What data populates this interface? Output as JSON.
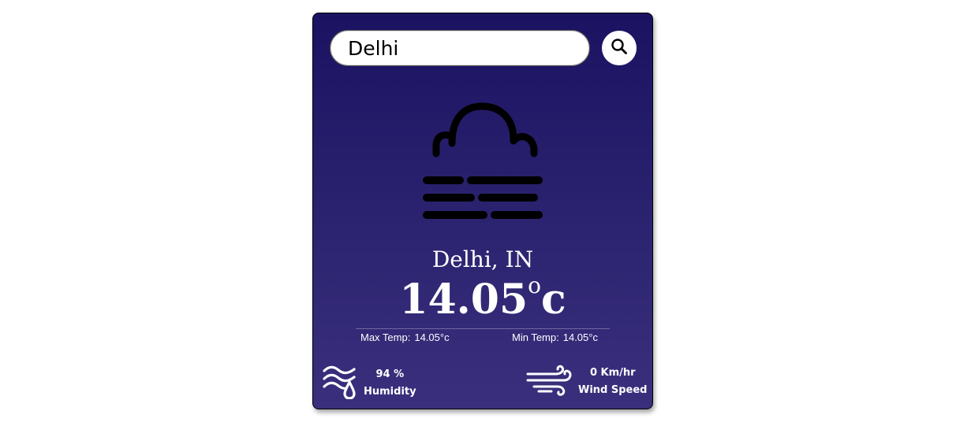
{
  "search": {
    "value": "Delhi"
  },
  "weather": {
    "city": "Delhi, IN",
    "temp": "14.05",
    "unit": "c",
    "degree_symbol": "o",
    "condition_icon": "fog-icon"
  },
  "range": {
    "max_label": "Max Temp:",
    "max_value": "14.05°c",
    "min_label": "Min Temp:",
    "min_value": "14.05°c"
  },
  "humidity": {
    "value": "94 %",
    "label": "Humidity",
    "icon": "humidity-icon"
  },
  "wind": {
    "value": "0 Km/hr",
    "label": "Wind Speed",
    "icon": "wind-icon"
  },
  "colors": {
    "card_top": "#1b1262",
    "card_bottom": "#3a2f7d",
    "text": "#ffffff"
  }
}
